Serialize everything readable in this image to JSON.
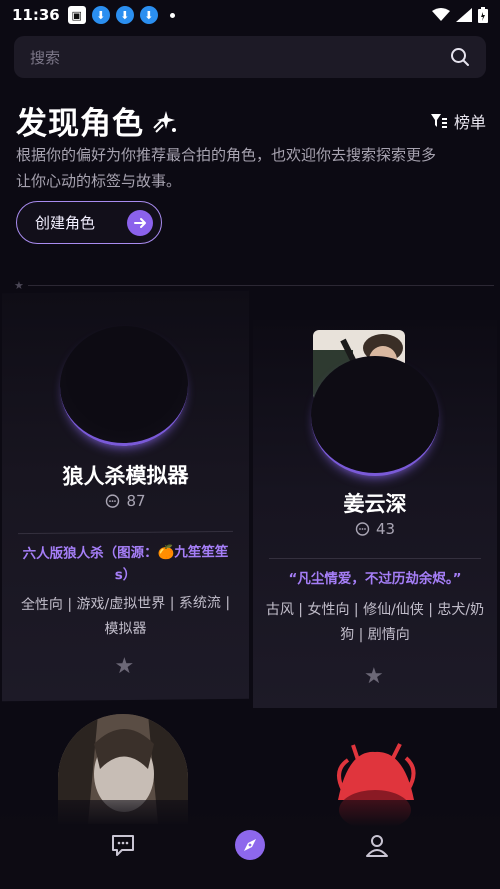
{
  "status": {
    "time": "11:36"
  },
  "search": {
    "placeholder": "搜索"
  },
  "header": {
    "title": "发现角色",
    "rank_label": "榜单",
    "description": "根据你的偏好为你推荐最合拍的角色，也欢迎你去搜索探索更多让你心动的标签与故事。",
    "create_label": "创建角色"
  },
  "cards": [
    {
      "name": "狼人杀模拟器",
      "count": "87",
      "tagline": "六人版狼人杀（图源：🍊九笙笙笙s）",
      "tags": "全性向 | 游戏/虚拟世界 | 系统流 | 模拟器"
    },
    {
      "name": "姜云深",
      "count": "43",
      "tagline": "“凡尘情爱，不过历劫余烬。”",
      "tags": "古风 | 女性向 | 修仙/仙侠 | 忠犬/奶狗 | 剧情向"
    }
  ],
  "colors": {
    "accent": "#8b62ec",
    "tagline": "#a57ef7",
    "background": "#0c0a13"
  }
}
